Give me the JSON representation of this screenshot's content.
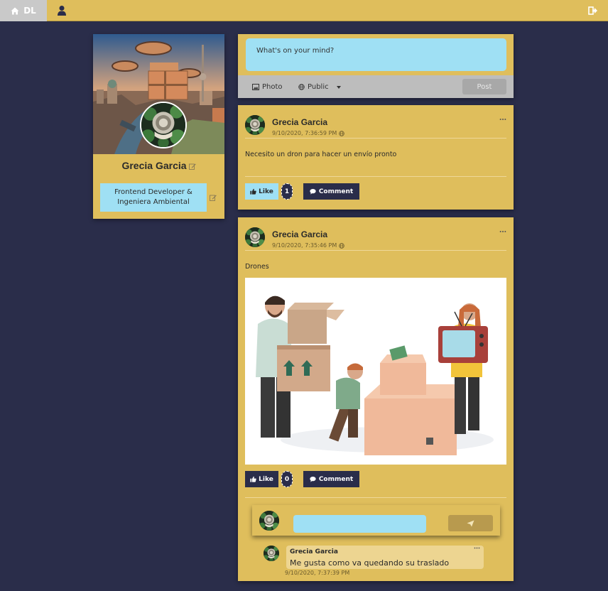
{
  "topbar": {
    "brand": "DL",
    "icons": [
      "home-icon",
      "user-icon",
      "logout-icon"
    ]
  },
  "profile": {
    "name": "Grecia Garcia",
    "bio": "Frontend Developer & Ingeniera Ambiental"
  },
  "composer": {
    "placeholder": "What's on your mind?",
    "photo_label": "Photo",
    "visibility_label": "Public",
    "post_label": "Post"
  },
  "posts": [
    {
      "author": "Grecia Garcia",
      "timestamp": "9/10/2020, 7:36:59 PM",
      "text": "Necesito un dron para hacer un envío pronto",
      "like_label": "Like",
      "like_count": "1",
      "comment_label": "Comment"
    },
    {
      "author": "Grecia Garcia",
      "timestamp": "9/10/2020, 7:35:46 PM",
      "text": "Drones",
      "like_label": "Like",
      "like_count": "0",
      "comment_label": "Comment",
      "comments": [
        {
          "author": "Grecia Garcia",
          "text": "Me gusta como va quedando su traslado",
          "timestamp": "9/10/2020, 7:37:39 PM"
        }
      ]
    }
  ],
  "colors": {
    "background": "#2a2d4a",
    "card": "#dfbe5c",
    "input": "#9fe0f4",
    "dark_button": "#2a2d4a"
  }
}
